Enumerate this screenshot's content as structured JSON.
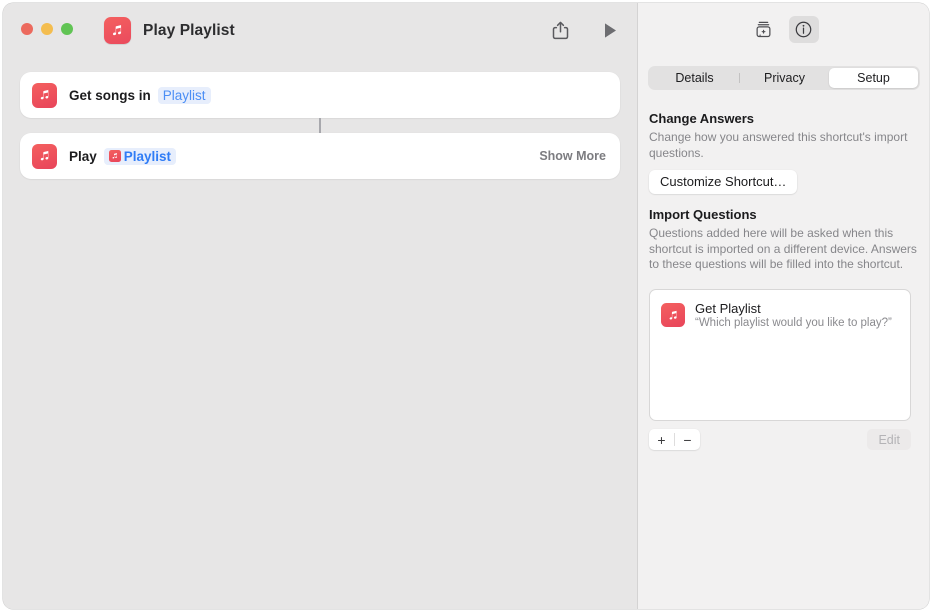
{
  "window": {
    "title": "Play Playlist",
    "app_icon": "music-note-icon",
    "traffic_lights": [
      "close-button",
      "minimize-button",
      "zoom-button"
    ],
    "toolbar": {
      "share_label": "share-icon",
      "run_label": "play-icon"
    }
  },
  "editor": {
    "actions": [
      {
        "icon": "music-note-icon",
        "text": "Get songs in",
        "token": "Playlist",
        "token_has_icon": false,
        "show_more": ""
      },
      {
        "icon": "music-note-icon",
        "text": "Play",
        "token": "Playlist",
        "token_has_icon": true,
        "show_more": "Show More"
      }
    ]
  },
  "inspector": {
    "toolbar": {
      "add_action_icon": "add-action-icon",
      "info_icon": "info-circle-icon"
    },
    "tabs": [
      {
        "label": "Details",
        "selected": false
      },
      {
        "label": "Privacy",
        "selected": false
      },
      {
        "label": "Setup",
        "selected": true
      }
    ],
    "change_answers": {
      "title": "Change Answers",
      "description": "Change how you answered this shortcut's import questions.",
      "button_label": "Customize Shortcut…"
    },
    "import_questions": {
      "title": "Import Questions",
      "description": "Questions added here will be asked when this shortcut is imported on a different device. Answers to these questions will be filled into the shortcut.",
      "items": [
        {
          "icon": "music-note-icon",
          "title": "Get Playlist",
          "prompt": "“Which playlist would you like to play?”"
        }
      ],
      "add_label": "+",
      "remove_label": "−",
      "edit_label": "Edit"
    }
  },
  "colors": {
    "accent_red": "#ea4a5d",
    "token_blue": "#4b8ef5",
    "canvas": "#e7e6e6",
    "sidebar": "#f2f1f1"
  }
}
